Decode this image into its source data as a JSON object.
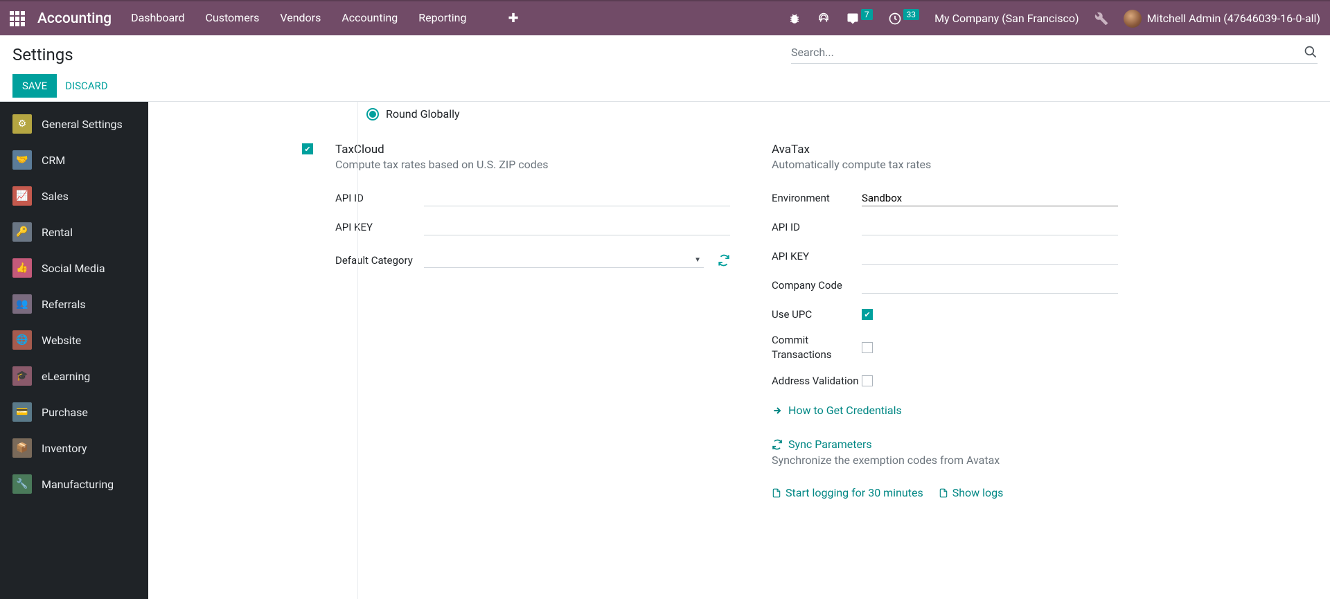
{
  "topbar": {
    "brand": "Accounting",
    "menu": [
      "Dashboard",
      "Customers",
      "Vendors",
      "Accounting",
      "Reporting"
    ],
    "msg_badge": "7",
    "activity_badge": "33",
    "company": "My Company (San Francisco)",
    "user": "Mitchell Admin (47646039-16-0-all)"
  },
  "control": {
    "title": "Settings",
    "save": "SAVE",
    "discard": "DISCARD",
    "search_placeholder": "Search..."
  },
  "sidebar": {
    "items": [
      {
        "label": "General Settings"
      },
      {
        "label": "CRM"
      },
      {
        "label": "Sales"
      },
      {
        "label": "Rental"
      },
      {
        "label": "Social Media"
      },
      {
        "label": "Referrals"
      },
      {
        "label": "Website"
      },
      {
        "label": "eLearning"
      },
      {
        "label": "Purchase"
      },
      {
        "label": "Inventory"
      },
      {
        "label": "Manufacturing"
      }
    ]
  },
  "content": {
    "round_globally": "Round Globally",
    "taxcloud": {
      "title": "TaxCloud",
      "desc": "Compute tax rates based on U.S. ZIP codes",
      "api_id_label": "API ID",
      "api_key_label": "API KEY",
      "default_cat_label": "Default Category"
    },
    "avatax": {
      "title": "AvaTax",
      "desc": "Automatically compute tax rates",
      "env_label": "Environment",
      "env_value": "Sandbox",
      "api_id_label": "API ID",
      "api_key_label": "API KEY",
      "company_code_label": "Company Code",
      "use_upc_label": "Use UPC",
      "commit_label": "Commit Transactions",
      "addr_label": "Address Validation",
      "how_credentials": "How to Get Credentials",
      "sync_params": "Sync Parameters",
      "sync_desc": "Synchronize the exemption codes from Avatax",
      "start_log": "Start logging for 30 minutes",
      "show_logs": "Show logs"
    }
  }
}
